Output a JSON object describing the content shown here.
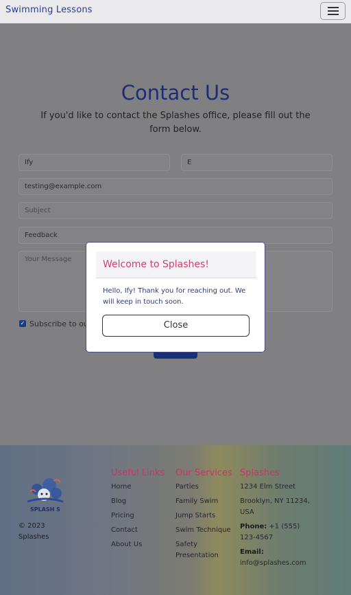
{
  "navbar": {
    "brand": "Swimming Lessons",
    "menu_icon": "hamburger-icon"
  },
  "page": {
    "title": "Contact Us",
    "subtitle": "If you'd like to contact the Splashes office, please fill out the form below."
  },
  "form": {
    "first_name_value": "Ify",
    "last_name_value": "E",
    "email_value": "testing@example.com",
    "subject_placeholder": "Subject",
    "feedback_value": "Feedback",
    "message_placeholder": "Your Message",
    "subscribe_label": "Subscribe to our",
    "subscribe_checked": true
  },
  "modal": {
    "title": "Welcome to Splashes!",
    "body": "Hello, Ify! Thank you for reaching out. We will keep in touch soon.",
    "close_label": "Close"
  },
  "footer": {
    "logo_text": "SPLASH S",
    "copyright": "© 2023 Splashes",
    "useful_links": {
      "heading": "Useful Links",
      "items": [
        "Home",
        "Blog",
        "Pricing",
        "Contact",
        "About Us"
      ]
    },
    "services": {
      "heading": "Our Services",
      "items": [
        "Parties",
        "Family Swim",
        "Jump Starts",
        "Swim Technique",
        "Safety Presentation"
      ]
    },
    "contact": {
      "heading": "Splashes",
      "street": "1234 Elm Street",
      "city": "Brooklyn, NY 11234, USA",
      "phone_label": "Phone:",
      "phone": "+1 (555) 123-4567",
      "email_label": "Email:",
      "email": "info@splashes.com"
    }
  },
  "colors": {
    "accent_pink": "#c93465",
    "brand_blue": "#1e2b78",
    "overlay": "#808083"
  }
}
